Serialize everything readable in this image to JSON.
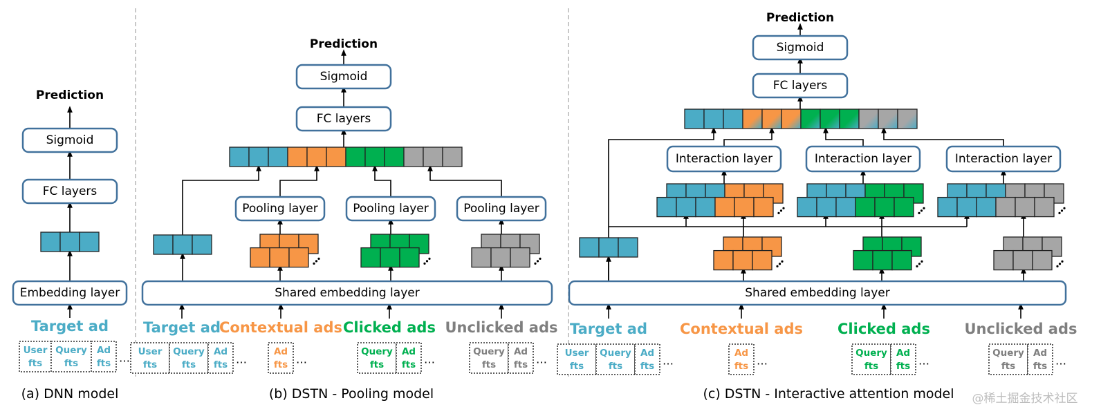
{
  "colors": {
    "target": "#4bacc6",
    "contextual": "#f79646",
    "clicked": "#00b050",
    "unclicked": "#a6a6a6",
    "box_border": "#41719c",
    "label_target": "#4bacc6",
    "label_contextual": "#f79646",
    "label_clicked": "#00b050",
    "label_unclicked": "#7f7f7f"
  },
  "common": {
    "prediction": "Prediction",
    "sigmoid": "Sigmoid",
    "fc_layers": "FC layers",
    "ellipsis": "…"
  },
  "panel_a": {
    "caption": "(a) DNN model",
    "embedding": "Embedding layer",
    "source": {
      "label": "Target ad",
      "kind": "target",
      "fields": [
        [
          "User",
          "fts"
        ],
        [
          "Query",
          "fts"
        ],
        [
          "Ad",
          "fts"
        ]
      ]
    }
  },
  "panel_b": {
    "caption": "(b) DSTN - Pooling model",
    "shared_embedding": "Shared embedding layer",
    "pooling": "Pooling layer",
    "sources": [
      {
        "label": "Target ad",
        "kind": "target",
        "fields": [
          [
            "User",
            "fts"
          ],
          [
            "Query",
            "fts"
          ],
          [
            "Ad",
            "fts"
          ]
        ]
      },
      {
        "label": "Contextual ads",
        "kind": "contextual",
        "fields": [
          [
            "Ad",
            "fts"
          ]
        ]
      },
      {
        "label": "Clicked ads",
        "kind": "clicked",
        "fields": [
          [
            "Query",
            "fts"
          ],
          [
            "Ad",
            "fts"
          ]
        ]
      },
      {
        "label": "Unclicked ads",
        "kind": "unclicked",
        "fields": [
          [
            "Query",
            "fts"
          ],
          [
            "Ad",
            "fts"
          ]
        ]
      }
    ]
  },
  "panel_c": {
    "caption": "(c) DSTN - Interactive attention model",
    "shared_embedding": "Shared embedding layer",
    "interaction": "Interaction layer",
    "sources": [
      {
        "label": "Target ad",
        "kind": "target",
        "fields": [
          [
            "User",
            "fts"
          ],
          [
            "Query",
            "fts"
          ],
          [
            "Ad",
            "fts"
          ]
        ]
      },
      {
        "label": "Contextual ads",
        "kind": "contextual",
        "fields": [
          [
            "Ad",
            "fts"
          ]
        ]
      },
      {
        "label": "Clicked ads",
        "kind": "clicked",
        "fields": [
          [
            "Query",
            "fts"
          ],
          [
            "Ad",
            "fts"
          ]
        ]
      },
      {
        "label": "Unclicked ads",
        "kind": "unclicked",
        "fields": [
          [
            "Query",
            "fts"
          ],
          [
            "Ad",
            "fts"
          ]
        ]
      }
    ]
  },
  "watermark": "@稀土掘金技术社区"
}
